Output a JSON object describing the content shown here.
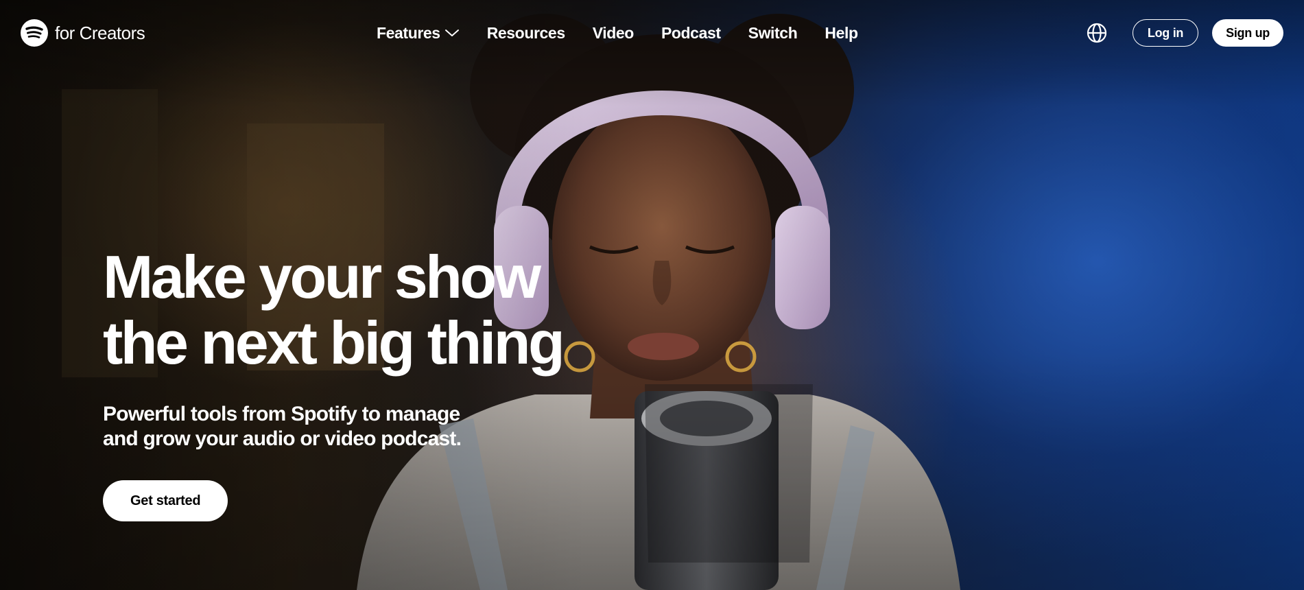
{
  "brand": {
    "name": "for Creators",
    "logo_icon": "spotify-logo-icon"
  },
  "nav": {
    "items": [
      {
        "label": "Features",
        "has_dropdown": true
      },
      {
        "label": "Resources"
      },
      {
        "label": "Video"
      },
      {
        "label": "Podcast"
      },
      {
        "label": "Switch"
      },
      {
        "label": "Help"
      }
    ],
    "language_icon": "globe-icon",
    "login_label": "Log in",
    "signup_label": "Sign up"
  },
  "hero": {
    "headline_line1": "Make your show",
    "headline_line2": "the next big thing",
    "subhead_line1": "Powerful tools from Spotify to manage",
    "subhead_line2": "and grow your audio or video podcast.",
    "cta_label": "Get started"
  },
  "colors": {
    "text": "#ffffff",
    "button_bg": "#ffffff",
    "button_text": "#000000",
    "accent_blue": "#0f3a86"
  }
}
